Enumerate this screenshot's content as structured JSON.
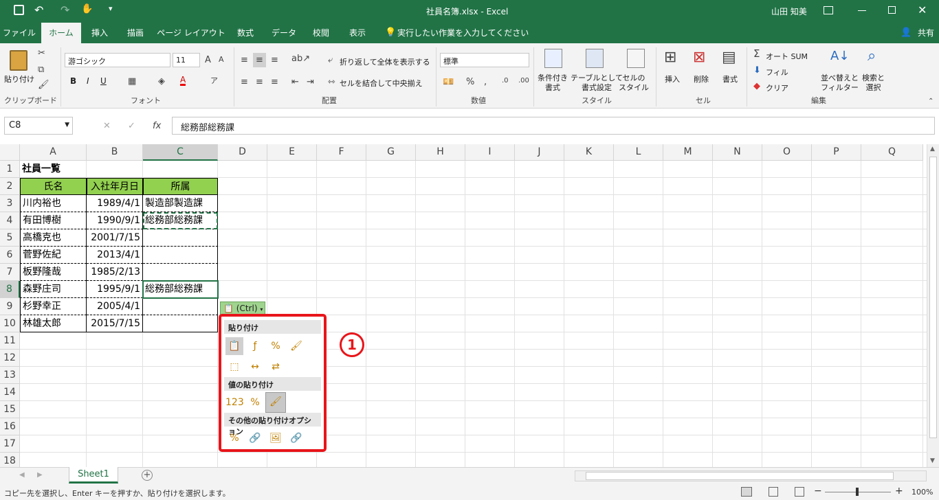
{
  "title_bar": {
    "file_title": "社員名簿.xlsx - Excel",
    "user": "山田 知美"
  },
  "tabs": [
    "ファイル",
    "ホーム",
    "挿入",
    "描画",
    "ページ レイアウト",
    "数式",
    "データ",
    "校閲",
    "表示"
  ],
  "tell_me": "実行したい作業を入力してください",
  "share": "共有",
  "ribbon": {
    "clipboard": {
      "paste": "貼り付け",
      "group": "クリップボード"
    },
    "font": {
      "name": "游ゴシック",
      "size": "11",
      "group": "フォント",
      "bold": "B",
      "italic": "I",
      "underline": "U"
    },
    "alignment": {
      "wrap": "折り返して全体を表示する",
      "merge": "セルを結合して中央揃え",
      "group": "配置"
    },
    "number": {
      "format": "標準",
      "group": "数値"
    },
    "styles": {
      "conditional": "条件付き\n書式",
      "table": "テーブルとして\n書式設定",
      "cell_style": "セルの\nスタイル",
      "group": "スタイル"
    },
    "cells": {
      "insert": "挿入",
      "delete": "削除",
      "format": "書式",
      "group": "セル"
    },
    "editing": {
      "autosum": "オート SUM",
      "fill": "フィル",
      "clear": "クリア",
      "sort": "並べ替えと\nフィルター",
      "find": "検索と\n選択",
      "group": "編集"
    }
  },
  "formula_bar": {
    "name_box": "C8",
    "fx": "fx",
    "content": "総務部総務課"
  },
  "columns": [
    "A",
    "B",
    "C",
    "D",
    "E",
    "F",
    "G",
    "H",
    "I",
    "J",
    "K",
    "L",
    "M",
    "N",
    "O",
    "P",
    "Q"
  ],
  "rows": [
    "1",
    "2",
    "3",
    "4",
    "5",
    "6",
    "7",
    "8",
    "9",
    "10",
    "11",
    "12",
    "13",
    "14",
    "15",
    "16",
    "17",
    "18"
  ],
  "cells": {
    "a1": "社員一覧",
    "headers": [
      "氏名",
      "入社年月日",
      "所属"
    ],
    "names": [
      "川内裕也",
      "有田博樹",
      "高橋克也",
      "菅野佐紀",
      "板野隆哉",
      "森野庄司",
      "杉野幸正",
      "林雄太郎"
    ],
    "dates": [
      "1989/4/1",
      "1990/9/1",
      "2001/7/15",
      "2013/4/1",
      "1985/2/13",
      "1995/9/1",
      "2005/4/1",
      "2015/7/15"
    ],
    "dept": [
      "製造部製造課",
      "総務部総務課",
      "",
      "",
      "",
      "総務部総務課",
      "",
      ""
    ]
  },
  "paste_button": "(Ctrl)",
  "paste_menu": {
    "section1": "貼り付け",
    "section2": "値の貼り付け",
    "section3": "その他の貼り付けオプション",
    "badge": "1"
  },
  "sheet_tab": "Sheet1",
  "status": {
    "message": "コピー先を選択し、Enter キーを押すか、貼り付けを選択します。",
    "zoom": "100%"
  },
  "colors": {
    "excel_green": "#217346",
    "header_fill": "#92d050",
    "menu_border": "#e8151a"
  }
}
